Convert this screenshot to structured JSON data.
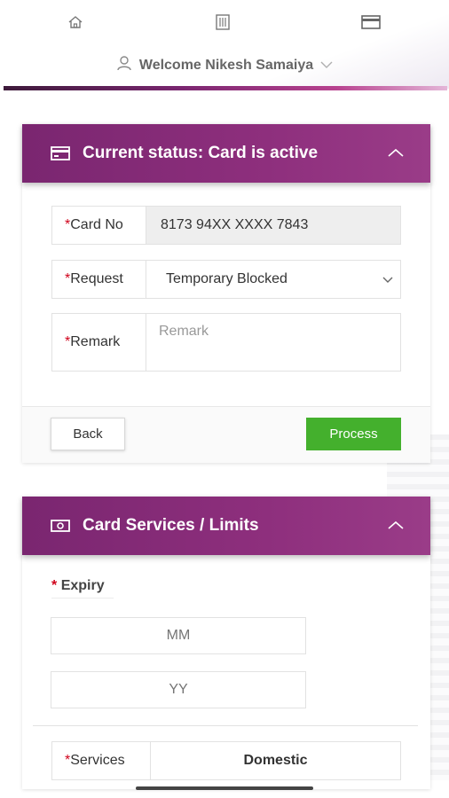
{
  "nav": {
    "items": [
      {
        "icon": "home-icon"
      },
      {
        "icon": "bank-icon"
      },
      {
        "icon": "card-icon"
      }
    ],
    "welcome_text": "Welcome Nikesh Samaiya",
    "user_icon": "user-icon",
    "chevron": "⌵"
  },
  "colors": {
    "panel_header": "#7a2670",
    "process_button": "#44b02d",
    "required_asterisk": "#d0021b"
  },
  "status_panel": {
    "title": "Current status: Card is active",
    "icon": "card-icon",
    "card_no_label": "Card No",
    "card_no_value": "8173 94XX XXXX 7843",
    "request_label": "Request",
    "request_value": "Temporary Blocked",
    "remark_label": "Remark",
    "remark_placeholder": "Remark",
    "required_mark": "*",
    "back_label": "Back",
    "process_label": "Process"
  },
  "services_panel": {
    "title": "Card Services / Limits",
    "icon": "money-icon",
    "expiry_label": "Expiry",
    "required_mark": "*",
    "mm_placeholder": "MM",
    "yy_placeholder": "YY",
    "services_label": "Services",
    "services_value": "Domestic"
  }
}
